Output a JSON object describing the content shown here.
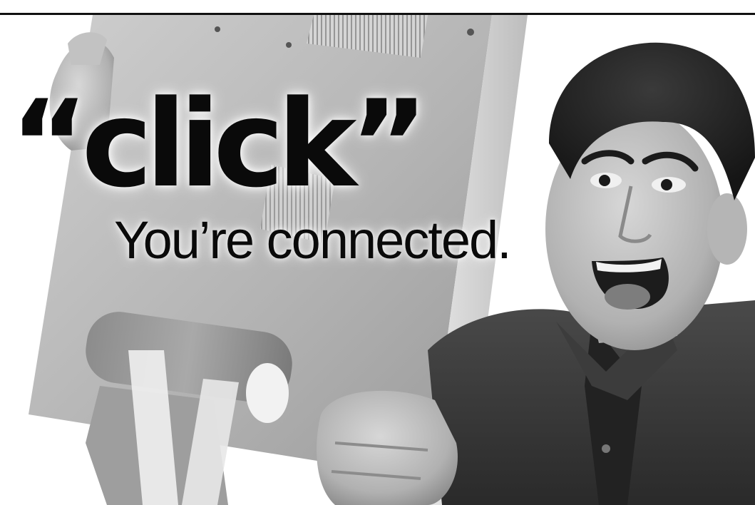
{
  "ad": {
    "headline": "“click”",
    "tagline": "You’re connected."
  },
  "image": {
    "subject": "excited man holding up a computer monitor",
    "style": "grayscale photograph"
  }
}
